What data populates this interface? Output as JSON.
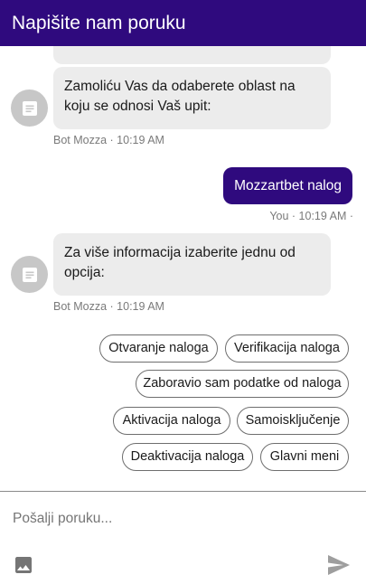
{
  "header": {
    "title": "Napišite nam poruku"
  },
  "messages": [
    {
      "sender": "bot",
      "text": "",
      "meta": ""
    },
    {
      "sender": "bot",
      "text": "Zamoliću Vas da odaberete oblast na koju se odnosi Vaš upit:",
      "meta": "Bot Mozza · 10:19 AM",
      "avatar_icon": "message-icon"
    },
    {
      "sender": "user",
      "text": "Mozzartbet nalog",
      "meta": "You · 10:19 AM ·"
    },
    {
      "sender": "bot",
      "text": "Za više informacija izaberite jednu od opcija:",
      "meta": "Bot Mozza · 10:19 AM",
      "avatar_icon": "message-icon"
    }
  ],
  "options": [
    "Otvaranje naloga",
    "Verifikacija naloga",
    "Zaboravio sam podatke od naloga",
    "Aktivacija naloga",
    "Samoisključenje",
    "Deaktivacija naloga",
    "Glavni meni"
  ],
  "composer": {
    "placeholder": "Pošalji poruku...",
    "value": "",
    "attach_icon": "image-icon",
    "send_icon": "send-icon"
  },
  "colors": {
    "brand": "#2f0a7e",
    "bot_bubble": "#ececec",
    "avatar": "#c7c7c7",
    "meta_text": "#7a7a7a",
    "icon": "#8f8f8f"
  }
}
